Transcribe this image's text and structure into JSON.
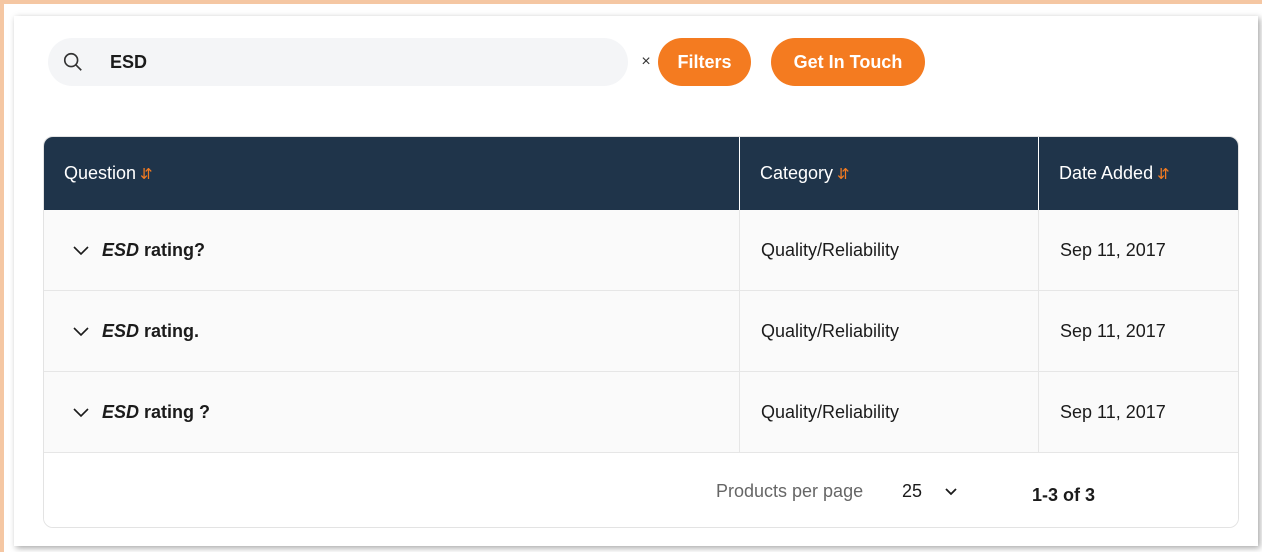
{
  "search": {
    "value": "ESD",
    "clear_label": "×",
    "icon": "search-icon"
  },
  "buttons": {
    "filters": "Filters",
    "get_in_touch": "Get In Touch"
  },
  "table": {
    "headers": {
      "question": "Question",
      "category": "Category",
      "date_added": "Date Added",
      "sort_glyph": "⇵"
    },
    "rows": [
      {
        "highlight": "ESD",
        "rest": " rating?",
        "category": "Quality/Reliability",
        "date": "Sep 11, 2017"
      },
      {
        "highlight": "ESD",
        "rest": " rating.",
        "category": "Quality/Reliability",
        "date": "Sep 11, 2017"
      },
      {
        "highlight": "ESD",
        "rest": " rating ?",
        "category": "Quality/Reliability",
        "date": "Sep 11, 2017"
      }
    ]
  },
  "pagination": {
    "per_page_label": "Products per page",
    "per_page_value": "25",
    "range": "1-3 of 3"
  },
  "colors": {
    "accent": "#f47b20",
    "header_bg": "#1f344a",
    "frame": "#f5c7a3"
  }
}
